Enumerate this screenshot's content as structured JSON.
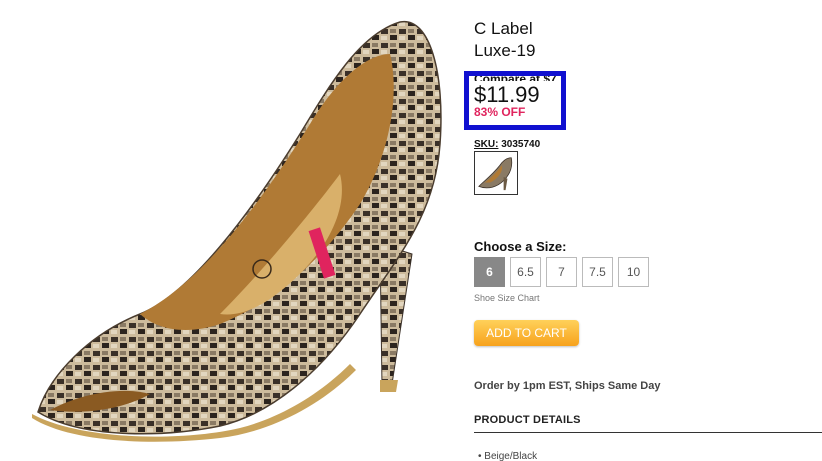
{
  "product": {
    "brand": "C Label",
    "model": "Luxe-19",
    "compare_at": "Compare at $7",
    "price": "$11.99",
    "discount": "83% OFF",
    "sku_label": "SKU:",
    "sku_value": "3035740",
    "size_title": "Choose a Size:",
    "sizes": [
      "6",
      "6.5",
      "7",
      "7.5",
      "10"
    ],
    "selected_size": "6",
    "size_chart": "Shoe Size Chart",
    "add_to_cart": "ADD TO CART",
    "shipping": "Order by 1pm EST, Ships Same Day",
    "details_heading": "PRODUCT DETAILS",
    "detail_item": "• Beige/Black"
  },
  "colors": {
    "highlight_box": "#1010d0",
    "discount": "#e0245e",
    "cart_button": "#f7a21c"
  }
}
